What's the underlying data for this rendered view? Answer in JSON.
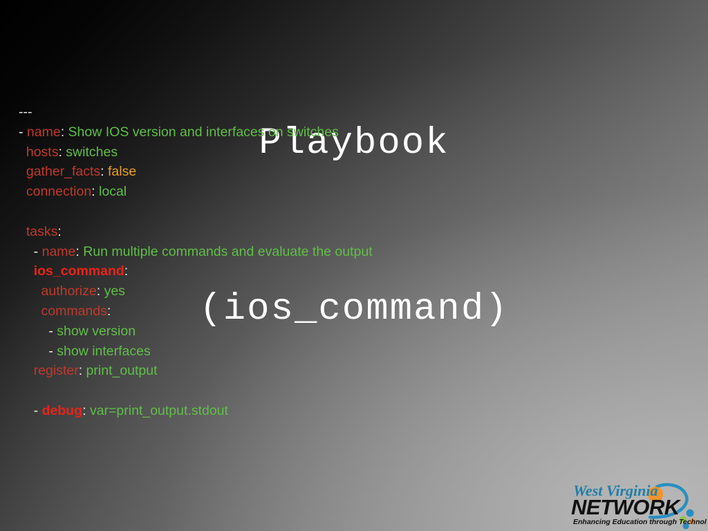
{
  "slide": {
    "title_lines": [
      "Playbook",
      "(ios_command)"
    ],
    "background": {
      "from": "#000000",
      "to": "#a6a6a6",
      "direction": "diagonal-top-left-to-bottom-right"
    }
  },
  "colors": {
    "title": "#ffffff",
    "key": "#c0392b",
    "key_strong": "#e8231a",
    "value": "#5fbf47",
    "boolean": "#e8a020",
    "punctuation": "#f0f0f0",
    "marker": "#e8e8e8"
  },
  "playbook": {
    "language": "yaml",
    "lines": [
      {
        "indent": 0,
        "tokens": [
          {
            "type": "marker",
            "text": "---"
          }
        ]
      },
      {
        "indent": 0,
        "tokens": [
          {
            "type": "dash",
            "text": "- "
          },
          {
            "type": "key",
            "text": "name"
          },
          {
            "type": "colon",
            "text": ": "
          },
          {
            "type": "value",
            "text": "Show IOS version and interfaces on switches"
          }
        ]
      },
      {
        "indent": 1,
        "tokens": [
          {
            "type": "key",
            "text": "hosts"
          },
          {
            "type": "colon",
            "text": ": "
          },
          {
            "type": "value",
            "text": "switches"
          }
        ]
      },
      {
        "indent": 1,
        "tokens": [
          {
            "type": "key",
            "text": "gather_facts"
          },
          {
            "type": "colon",
            "text": ": "
          },
          {
            "type": "boolean",
            "text": "false"
          }
        ]
      },
      {
        "indent": 1,
        "tokens": [
          {
            "type": "key",
            "text": "connection"
          },
          {
            "type": "colon",
            "text": ": "
          },
          {
            "type": "value",
            "text": "local"
          }
        ]
      },
      {
        "indent": 0,
        "tokens": []
      },
      {
        "indent": 1,
        "tokens": [
          {
            "type": "key",
            "text": "tasks"
          },
          {
            "type": "colon",
            "text": ":"
          }
        ]
      },
      {
        "indent": 1,
        "tokens": [
          {
            "type": "dash",
            "text": "  - "
          },
          {
            "type": "key",
            "text": "name"
          },
          {
            "type": "colon",
            "text": ": "
          },
          {
            "type": "value",
            "text": "Run multiple commands and evaluate the output"
          }
        ]
      },
      {
        "indent": 2,
        "tokens": [
          {
            "type": "key_strong",
            "text": "ios_command"
          },
          {
            "type": "colon",
            "text": ":"
          }
        ]
      },
      {
        "indent": 3,
        "tokens": [
          {
            "type": "key",
            "text": "authorize"
          },
          {
            "type": "colon",
            "text": ": "
          },
          {
            "type": "value",
            "text": "yes"
          }
        ]
      },
      {
        "indent": 3,
        "tokens": [
          {
            "type": "key",
            "text": "commands"
          },
          {
            "type": "colon",
            "text": ":"
          }
        ]
      },
      {
        "indent": 4,
        "tokens": [
          {
            "type": "dash",
            "text": "- "
          },
          {
            "type": "value",
            "text": "show version"
          }
        ]
      },
      {
        "indent": 4,
        "tokens": [
          {
            "type": "dash",
            "text": "- "
          },
          {
            "type": "value",
            "text": "show interfaces"
          }
        ]
      },
      {
        "indent": 2,
        "tokens": [
          {
            "type": "key",
            "text": "register"
          },
          {
            "type": "colon",
            "text": ": "
          },
          {
            "type": "value",
            "text": "print_output"
          }
        ]
      },
      {
        "indent": 0,
        "tokens": []
      },
      {
        "indent": 1,
        "tokens": [
          {
            "type": "dash",
            "text": "  - "
          },
          {
            "type": "key_strong",
            "text": "debug"
          },
          {
            "type": "colon",
            "text": ": "
          },
          {
            "type": "value",
            "text": "var=print_output.stdout"
          }
        ]
      }
    ]
  },
  "logo": {
    "name": "west-virginia-network-logo",
    "script_text": "West Virginia",
    "wordmark_text": "NETWORK",
    "tagline_text": "Enhancing Education through Technology",
    "script_color": "#1f7fa8",
    "wordmark_color": "#111111",
    "tagline_color": "#111111",
    "accent_orange": "#f0932b",
    "accent_blue": "#2a8fc0",
    "accent_green": "#8dc63f"
  }
}
